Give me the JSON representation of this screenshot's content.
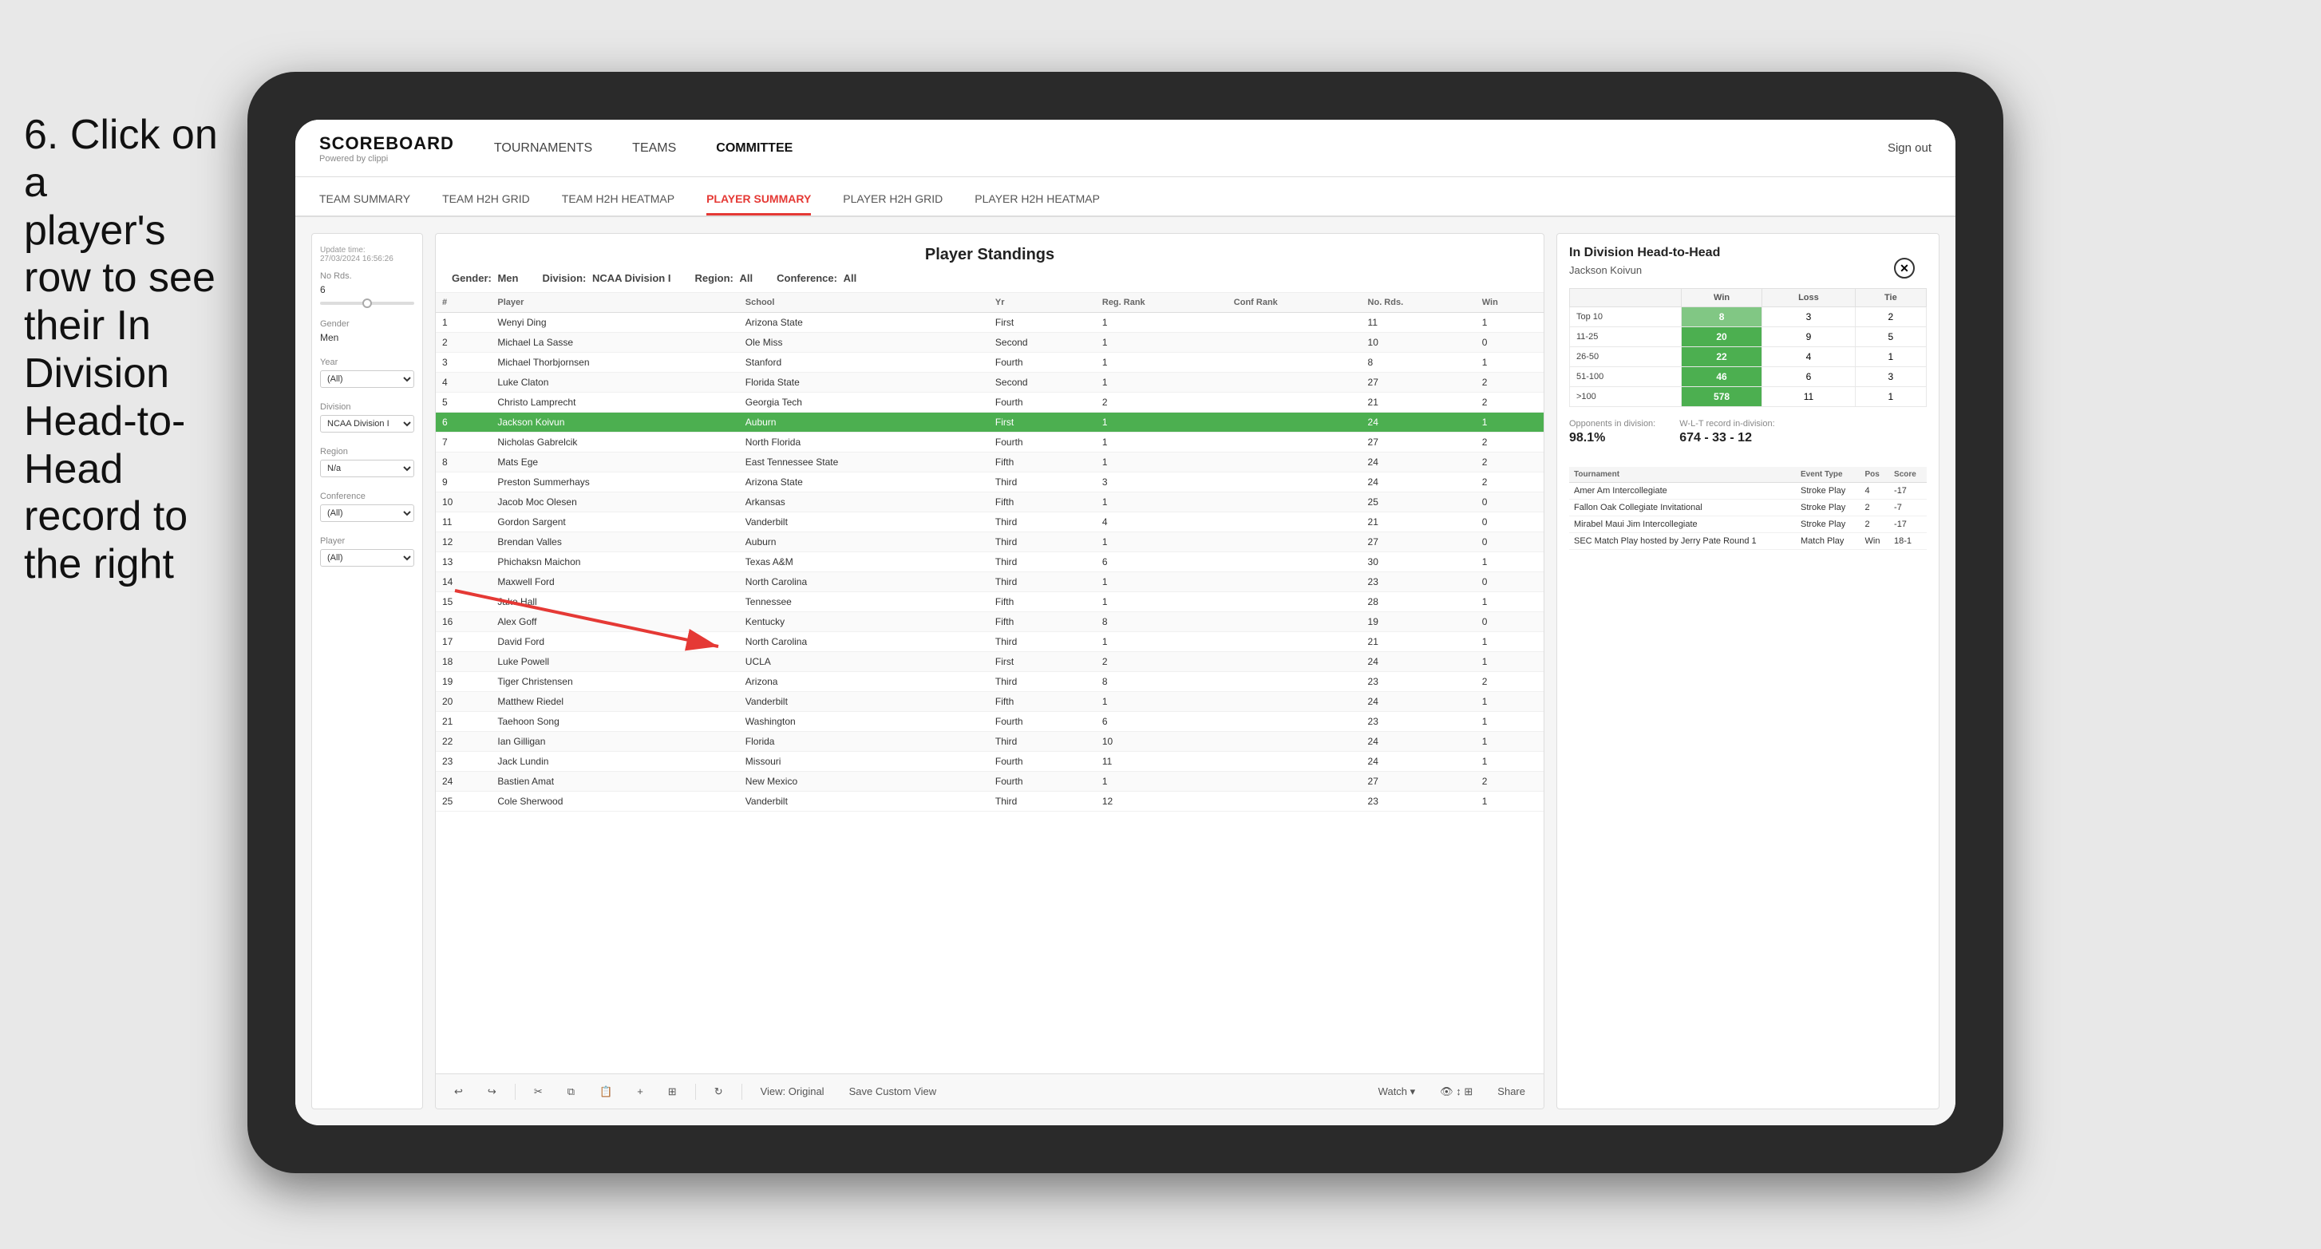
{
  "instruction": {
    "line1": "6. Click on a",
    "line2": "player's row to see",
    "line3": "their In Division",
    "line4": "Head-to-Head",
    "line5": "record to the right"
  },
  "nav": {
    "logo": "SCOREBOARD",
    "logo_sub": "Powered by clippi",
    "links": [
      "TOURNAMENTS",
      "TEAMS",
      "COMMITTEE"
    ],
    "sign_out": "Sign out"
  },
  "sub_nav": {
    "items": [
      "TEAM SUMMARY",
      "TEAM H2H GRID",
      "TEAM H2H HEATMAP",
      "PLAYER SUMMARY",
      "PLAYER H2H GRID",
      "PLAYER H2H HEATMAP"
    ],
    "active": "PLAYER SUMMARY"
  },
  "sidebar": {
    "update_label": "Update time:",
    "update_value": "27/03/2024 16:56:26",
    "no_rds_label": "No Rds.",
    "no_rds_value": "6",
    "gender_label": "Gender",
    "gender_value": "Men",
    "year_label": "Year",
    "year_value": "(All)",
    "division_label": "Division",
    "division_value": "NCAA Division I",
    "region_label": "Region",
    "region_value": "N/a",
    "conference_label": "Conference",
    "conference_value": "(All)",
    "player_label": "Player",
    "player_value": "(All)"
  },
  "player_standings": {
    "title": "Player Standings",
    "gender_label": "Gender:",
    "gender_value": "Men",
    "division_label": "Division:",
    "division_value": "NCAA Division I",
    "region_label": "Region:",
    "region_value": "All",
    "conference_label": "Conference:",
    "conference_value": "All",
    "columns": [
      "#",
      "Player",
      "School",
      "Yr",
      "Reg. Rank",
      "Conf Rank",
      "No. Rds.",
      "Win"
    ],
    "rows": [
      {
        "num": 1,
        "player": "Wenyi Ding",
        "school": "Arizona State",
        "yr": "First",
        "reg_rank": 1,
        "conf_rank": "",
        "no_rds": 11,
        "win": 1
      },
      {
        "num": 2,
        "player": "Michael La Sasse",
        "school": "Ole Miss",
        "yr": "Second",
        "reg_rank": 1,
        "conf_rank": "",
        "no_rds": 10,
        "win": 0
      },
      {
        "num": 3,
        "player": "Michael Thorbjornsen",
        "school": "Stanford",
        "yr": "Fourth",
        "reg_rank": 1,
        "conf_rank": "",
        "no_rds": 8,
        "win": 1
      },
      {
        "num": 4,
        "player": "Luke Claton",
        "school": "Florida State",
        "yr": "Second",
        "reg_rank": 1,
        "conf_rank": "",
        "no_rds": 27,
        "win": 2
      },
      {
        "num": 5,
        "player": "Christo Lamprecht",
        "school": "Georgia Tech",
        "yr": "Fourth",
        "reg_rank": 2,
        "conf_rank": "",
        "no_rds": 21,
        "win": 2
      },
      {
        "num": 6,
        "player": "Jackson Koivun",
        "school": "Auburn",
        "yr": "First",
        "reg_rank": 1,
        "conf_rank": "",
        "no_rds": 24,
        "win": 1,
        "highlighted": true
      },
      {
        "num": 7,
        "player": "Nicholas Gabrelcik",
        "school": "North Florida",
        "yr": "Fourth",
        "reg_rank": 1,
        "conf_rank": "",
        "no_rds": 27,
        "win": 2
      },
      {
        "num": 8,
        "player": "Mats Ege",
        "school": "East Tennessee State",
        "yr": "Fifth",
        "reg_rank": 1,
        "conf_rank": "",
        "no_rds": 24,
        "win": 2
      },
      {
        "num": 9,
        "player": "Preston Summerhays",
        "school": "Arizona State",
        "yr": "Third",
        "reg_rank": 3,
        "conf_rank": "",
        "no_rds": 24,
        "win": 2
      },
      {
        "num": 10,
        "player": "Jacob Moc Olesen",
        "school": "Arkansas",
        "yr": "Fifth",
        "reg_rank": 1,
        "conf_rank": "",
        "no_rds": 25,
        "win": 0
      },
      {
        "num": 11,
        "player": "Gordon Sargent",
        "school": "Vanderbilt",
        "yr": "Third",
        "reg_rank": 4,
        "conf_rank": "",
        "no_rds": 21,
        "win": 0
      },
      {
        "num": 12,
        "player": "Brendan Valles",
        "school": "Auburn",
        "yr": "Third",
        "reg_rank": 1,
        "conf_rank": "",
        "no_rds": 27,
        "win": 0
      },
      {
        "num": 13,
        "player": "Phichaksn Maichon",
        "school": "Texas A&M",
        "yr": "Third",
        "reg_rank": 6,
        "conf_rank": "",
        "no_rds": 30,
        "win": 1
      },
      {
        "num": 14,
        "player": "Maxwell Ford",
        "school": "North Carolina",
        "yr": "Third",
        "reg_rank": 1,
        "conf_rank": "",
        "no_rds": 23,
        "win": 0
      },
      {
        "num": 15,
        "player": "Jake Hall",
        "school": "Tennessee",
        "yr": "Fifth",
        "reg_rank": 1,
        "conf_rank": "",
        "no_rds": 28,
        "win": 1
      },
      {
        "num": 16,
        "player": "Alex Goff",
        "school": "Kentucky",
        "yr": "Fifth",
        "reg_rank": 8,
        "conf_rank": "",
        "no_rds": 19,
        "win": 0
      },
      {
        "num": 17,
        "player": "David Ford",
        "school": "North Carolina",
        "yr": "Third",
        "reg_rank": 1,
        "conf_rank": "",
        "no_rds": 21,
        "win": 1
      },
      {
        "num": 18,
        "player": "Luke Powell",
        "school": "UCLA",
        "yr": "First",
        "reg_rank": 2,
        "conf_rank": "",
        "no_rds": 24,
        "win": 1
      },
      {
        "num": 19,
        "player": "Tiger Christensen",
        "school": "Arizona",
        "yr": "Third",
        "reg_rank": 8,
        "conf_rank": "",
        "no_rds": 23,
        "win": 2
      },
      {
        "num": 20,
        "player": "Matthew Riedel",
        "school": "Vanderbilt",
        "yr": "Fifth",
        "reg_rank": 1,
        "conf_rank": "",
        "no_rds": 24,
        "win": 1
      },
      {
        "num": 21,
        "player": "Taehoon Song",
        "school": "Washington",
        "yr": "Fourth",
        "reg_rank": 6,
        "conf_rank": "",
        "no_rds": 23,
        "win": 1
      },
      {
        "num": 22,
        "player": "Ian Gilligan",
        "school": "Florida",
        "yr": "Third",
        "reg_rank": 10,
        "conf_rank": "",
        "no_rds": 24,
        "win": 1
      },
      {
        "num": 23,
        "player": "Jack Lundin",
        "school": "Missouri",
        "yr": "Fourth",
        "reg_rank": 11,
        "conf_rank": "",
        "no_rds": 24,
        "win": 1
      },
      {
        "num": 24,
        "player": "Bastien Amat",
        "school": "New Mexico",
        "yr": "Fourth",
        "reg_rank": 1,
        "conf_rank": "",
        "no_rds": 27,
        "win": 2
      },
      {
        "num": 25,
        "player": "Cole Sherwood",
        "school": "Vanderbilt",
        "yr": "Third",
        "reg_rank": 12,
        "conf_rank": "",
        "no_rds": 23,
        "win": 1
      }
    ]
  },
  "h2h": {
    "title": "In Division Head-to-Head",
    "player_name": "Jackson Koivun",
    "table_headers": [
      "",
      "Win",
      "Loss",
      "Tie"
    ],
    "rows": [
      {
        "rank": "Top 10",
        "win": 8,
        "loss": 3,
        "tie": 2,
        "win_strong": false
      },
      {
        "rank": "11-25",
        "win": 20,
        "loss": 9,
        "tie": 5,
        "win_strong": true
      },
      {
        "rank": "26-50",
        "win": 22,
        "loss": 4,
        "tie": 1,
        "win_strong": true
      },
      {
        "rank": "51-100",
        "win": 46,
        "loss": 6,
        "tie": 3,
        "win_strong": true
      },
      {
        "rank": ">100",
        "win": 578,
        "loss": 11,
        "tie": 1,
        "win_strong": true
      }
    ],
    "opponents_label": "Opponents in division:",
    "opponents_wlt_label": "W-L-T record in-division:",
    "opponents_pct": "98.1%",
    "opponents_wlt": "674 - 33 - 12",
    "tournament_headers": [
      "Tournament",
      "Event Type",
      "Pos",
      "Score"
    ],
    "tournament_rows": [
      {
        "tournament": "Amer Am Intercollegiate",
        "type": "Stroke Play",
        "pos": 4,
        "score": "-17"
      },
      {
        "tournament": "Fallon Oak Collegiate Invitational",
        "type": "Stroke Play",
        "pos": 2,
        "score": "-7"
      },
      {
        "tournament": "Mirabel Maui Jim Intercollegiate",
        "type": "Stroke Play",
        "pos": 2,
        "score": "-17"
      },
      {
        "tournament": "SEC Match Play hosted by Jerry Pate Round 1",
        "type": "Match Play",
        "pos": "Win",
        "score": "18-1"
      }
    ]
  },
  "toolbar": {
    "undo": "↩",
    "redo": "↪",
    "view_original": "View: Original",
    "save_custom": "Save Custom View",
    "watch": "Watch ▾",
    "share": "Share"
  }
}
